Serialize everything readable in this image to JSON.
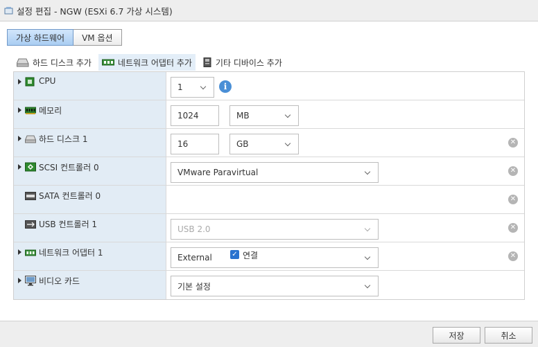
{
  "window": {
    "title": "설정 편집 - NGW (ESXi 6.7 가상 시스템)"
  },
  "tabs": [
    {
      "label": "가상 하드웨어",
      "active": true
    },
    {
      "label": "VM 옵션",
      "active": false
    }
  ],
  "toolbar": {
    "add_disk": "하드 디스크 추가",
    "add_network": "네트워크 어댑터 추가",
    "add_other": "기타 디바이스 추가"
  },
  "devices": {
    "cpu": {
      "label": "CPU",
      "value": "1"
    },
    "memory": {
      "label": "메모리",
      "value": "1024",
      "unit": "MB"
    },
    "disk": {
      "label": "하드 디스크 1",
      "value": "16",
      "unit": "GB"
    },
    "scsi": {
      "label": "SCSI 컨트롤러 0",
      "value": "VMware Paravirtual"
    },
    "sata": {
      "label": "SATA 컨트롤러 0"
    },
    "usb": {
      "label": "USB 컨트롤러 1",
      "value": "USB 2.0"
    },
    "network": {
      "label": "네트워크 어댑터 1",
      "value": "External",
      "connect_label": "연결",
      "connected": true
    },
    "video": {
      "label": "비디오 카드",
      "value": "기본 설정"
    }
  },
  "footer": {
    "save": "저장",
    "cancel": "취소"
  },
  "colors": {
    "accent": "#4a8fd6",
    "label_bg": "#e2ecf5",
    "checkbox": "#2a73cf"
  }
}
